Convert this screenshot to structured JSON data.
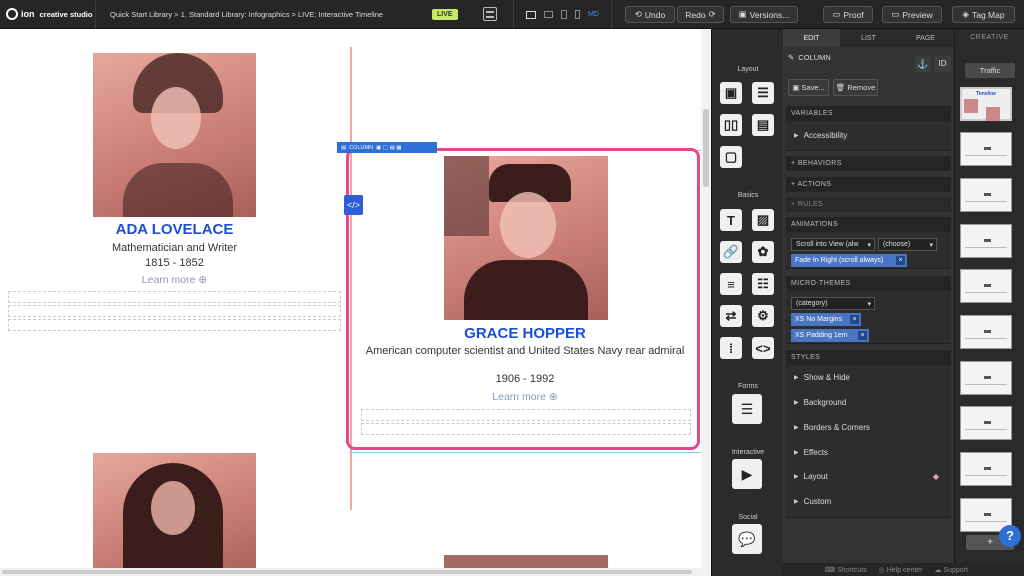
{
  "app": {
    "logo_text": "creative studio",
    "logo_mark": "ion"
  },
  "breadcrumb": "Quick Start Library > 1. Standard Library: Infographics > LIVE: Interactive Timeline",
  "status_badge": "LIVE",
  "devices": {
    "md_label": "MD"
  },
  "toolbar": {
    "undo": "Undo",
    "redo": "Redo",
    "versions": "Versions...",
    "proof": "Proof",
    "preview": "Preview",
    "tagmap": "Tag Map"
  },
  "canvas": {
    "person1": {
      "name": "ADA LOVELACE",
      "title": "Mathematician and Writer",
      "years": "1815 - 1852",
      "link": "Learn more"
    },
    "person2": {
      "name": "GRACE HOPPER",
      "title": "American computer scientist and United States Navy rear admiral",
      "years": "1906 - 1992",
      "link": "Learn more"
    },
    "column_tag": "COLUMN"
  },
  "tools": {
    "layout": "Layout",
    "basics": "Basics",
    "forms": "Forms",
    "interactive": "Interactive",
    "social": "Social"
  },
  "props": {
    "tabs": [
      "EDIT",
      "LIST",
      "PAGE"
    ],
    "element": "COLUMN",
    "id_label": "ID",
    "save": "Save...",
    "remove": "Remove",
    "variables": "VARIABLES",
    "accessibility": "Accessibility",
    "behaviors": "+ BEHAVIORS",
    "actions": "+ ACTIONS",
    "rules": "+ RULES",
    "animations": "ANIMATIONS",
    "anim_trigger": "Scroll into View (alw",
    "anim_choose": "(choose)",
    "anim_chip": "Fade In Right (scroll always)",
    "microthemes": "MICRO-THEMES",
    "category": "(category)",
    "theme1": "XS No Margins",
    "theme2": "XS Padding 1em",
    "styles": "STYLES",
    "style_rows": [
      "Show & Hide",
      "Background",
      "Borders & Corners",
      "Effects",
      "Layout",
      "Custom"
    ]
  },
  "creative": {
    "header": "CREATIVE",
    "traffic": "Traffic",
    "timeline_label": "Timeline",
    "add": "+"
  },
  "footer": {
    "shortcuts": "Shortcuts",
    "help": "Help center",
    "support": "Support"
  }
}
